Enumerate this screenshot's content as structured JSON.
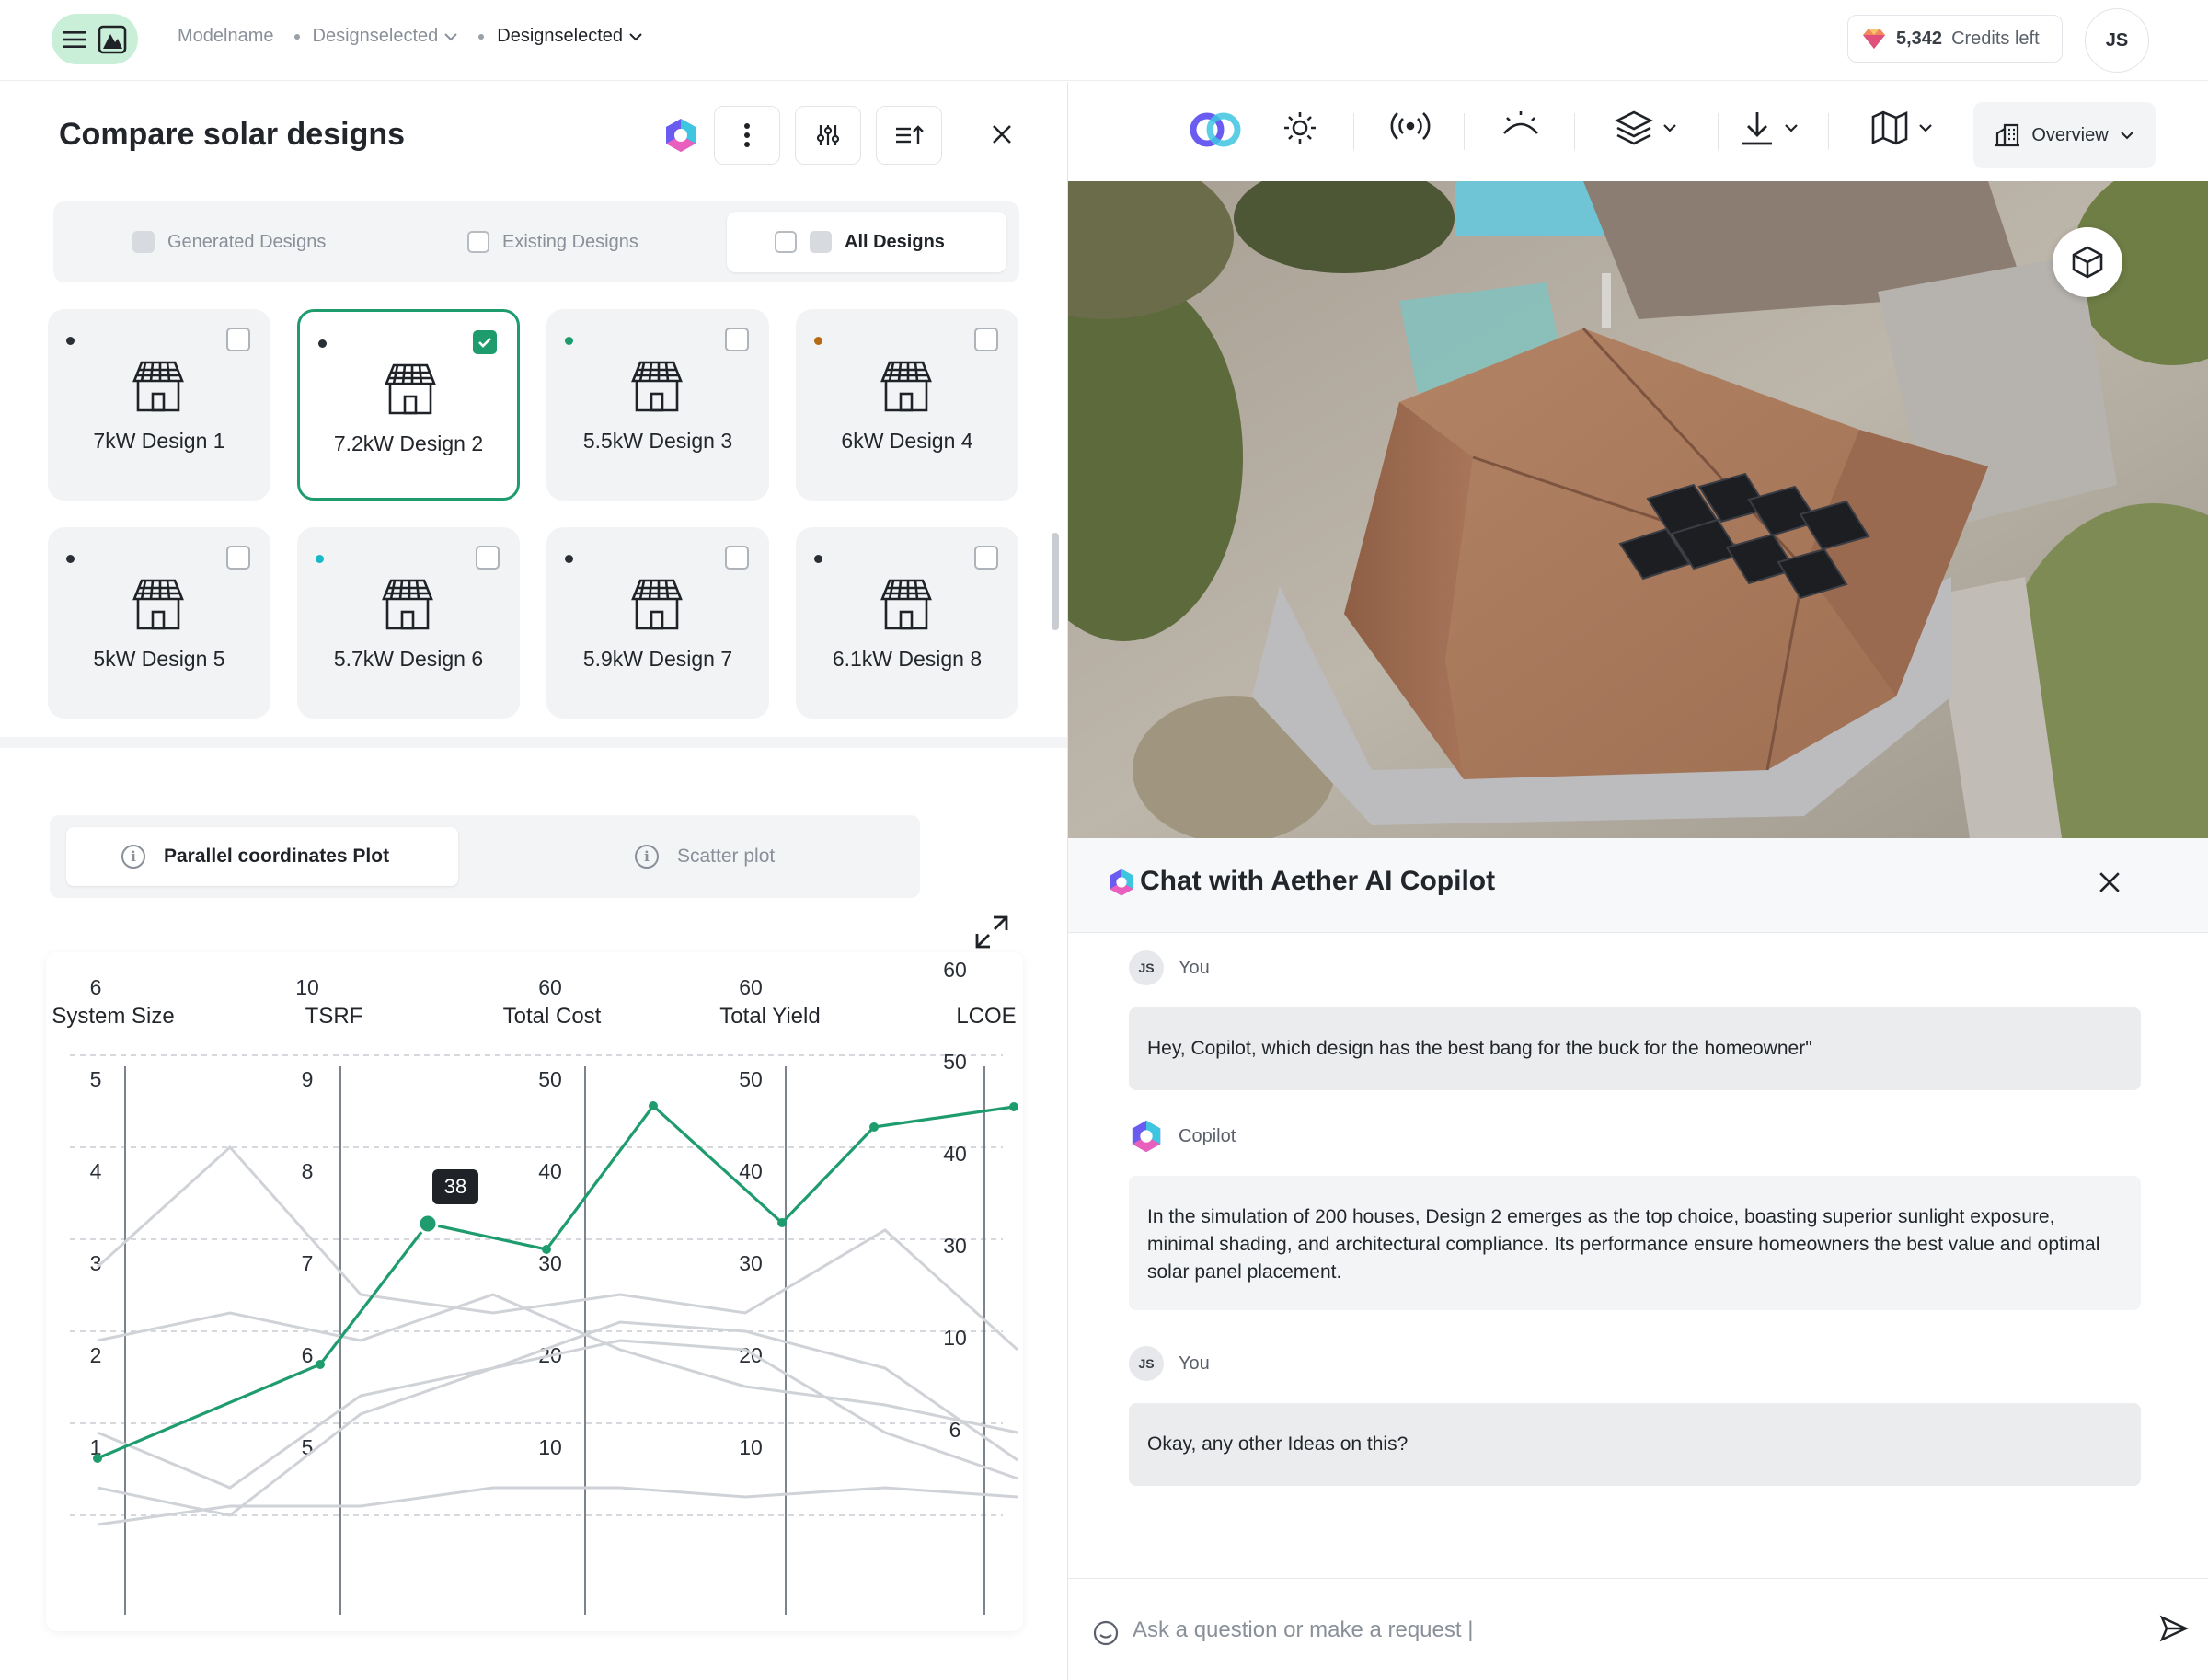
{
  "breadcrumbs": [
    {
      "label": "Modelname"
    },
    {
      "label": "Designselected"
    },
    {
      "label": "Designselected"
    }
  ],
  "credits": {
    "count": "5,342",
    "suffix": "Credits left"
  },
  "user": {
    "initials": "JS"
  },
  "panel": {
    "title": "Compare solar designs"
  },
  "design_filter": {
    "tabs": [
      "Generated Designs",
      "Existing Designs",
      "All Designs"
    ],
    "active": "All Designs"
  },
  "designs": [
    {
      "label": "7kW Design 1",
      "dot": "#2a2f36",
      "selected": false
    },
    {
      "label": "7.2kW Design 2",
      "dot": "#2a2f36",
      "selected": true
    },
    {
      "label": "5.5kW Design 3",
      "dot": "#1f9c6e",
      "selected": false
    },
    {
      "label": "6kW Design 4",
      "dot": "#b86a12",
      "selected": false
    },
    {
      "label": "5kW Design 5",
      "dot": "#2a2f36",
      "selected": false
    },
    {
      "label": "5.7kW Design 6",
      "dot": "#18b8c9",
      "selected": false
    },
    {
      "label": "5.9kW Design 7",
      "dot": "#2a2f36",
      "selected": false
    },
    {
      "label": "6.1kW Design 8",
      "dot": "#2a2f36",
      "selected": false
    }
  ],
  "plot_tabs": {
    "parallel": "Parallel coordinates Plot",
    "scatter": "Scatter plot"
  },
  "chart_data": {
    "type": "line",
    "axes": [
      {
        "name": "System Size",
        "ticks": [
          "6",
          "5",
          "4",
          "3",
          "2",
          "1"
        ]
      },
      {
        "name": "TSRF",
        "ticks": [
          "10",
          "9",
          "8",
          "7",
          "6",
          "5"
        ]
      },
      {
        "name": "Total Cost",
        "ticks": [
          "60",
          "50",
          "40",
          "30",
          "20",
          "10"
        ]
      },
      {
        "name": "Total Yield",
        "ticks": [
          "60",
          "50",
          "40",
          "30",
          "20",
          "10"
        ]
      },
      {
        "name": "LCOE",
        "ticks": [
          "60",
          "50",
          "40",
          "30",
          "10",
          "6"
        ]
      }
    ],
    "highlight": {
      "values": [
        1,
        6,
        38,
        54,
        40,
        52,
        53
      ],
      "tooltip": "38",
      "color": "#1f9c6e"
    },
    "background_series": [
      [
        3.7,
        5.0,
        3.4,
        3.2,
        3.4,
        3.2,
        4.1,
        2.8
      ],
      [
        2.9,
        3.2,
        2.9,
        3.4,
        2.8,
        2.4,
        2.2,
        1.9
      ],
      [
        1.9,
        1.3,
        2.3,
        2.6,
        3.1,
        3.0,
        2.6,
        1.6
      ],
      [
        1.3,
        1.0,
        2.1,
        2.6,
        2.9,
        2.8,
        1.9,
        1.4
      ],
      [
        0.9,
        1.1,
        1.1,
        1.3,
        1.3,
        1.2,
        1.3,
        1.2
      ]
    ],
    "grid": true
  },
  "map_toolbar": {
    "view": "Overview"
  },
  "chat": {
    "title": "Chat with Aether AI Copilot",
    "messages": [
      {
        "author": "You",
        "initials": "JS",
        "text": "Hey, Copilot, which design has the best bang for the buck for the homeowner\""
      },
      {
        "author": "Copilot",
        "text": "In the simulation of 200 houses, Design 2 emerges as the top choice, boasting superior sunlight exposure, minimal shading, and architectural compliance. Its performance ensure homeowners the best value and optimal solar panel placement."
      },
      {
        "author": "You",
        "initials": "JS",
        "text": "Okay,  any other Ideas on this?"
      }
    ],
    "input_placeholder": "Ask a question or make a request |"
  }
}
